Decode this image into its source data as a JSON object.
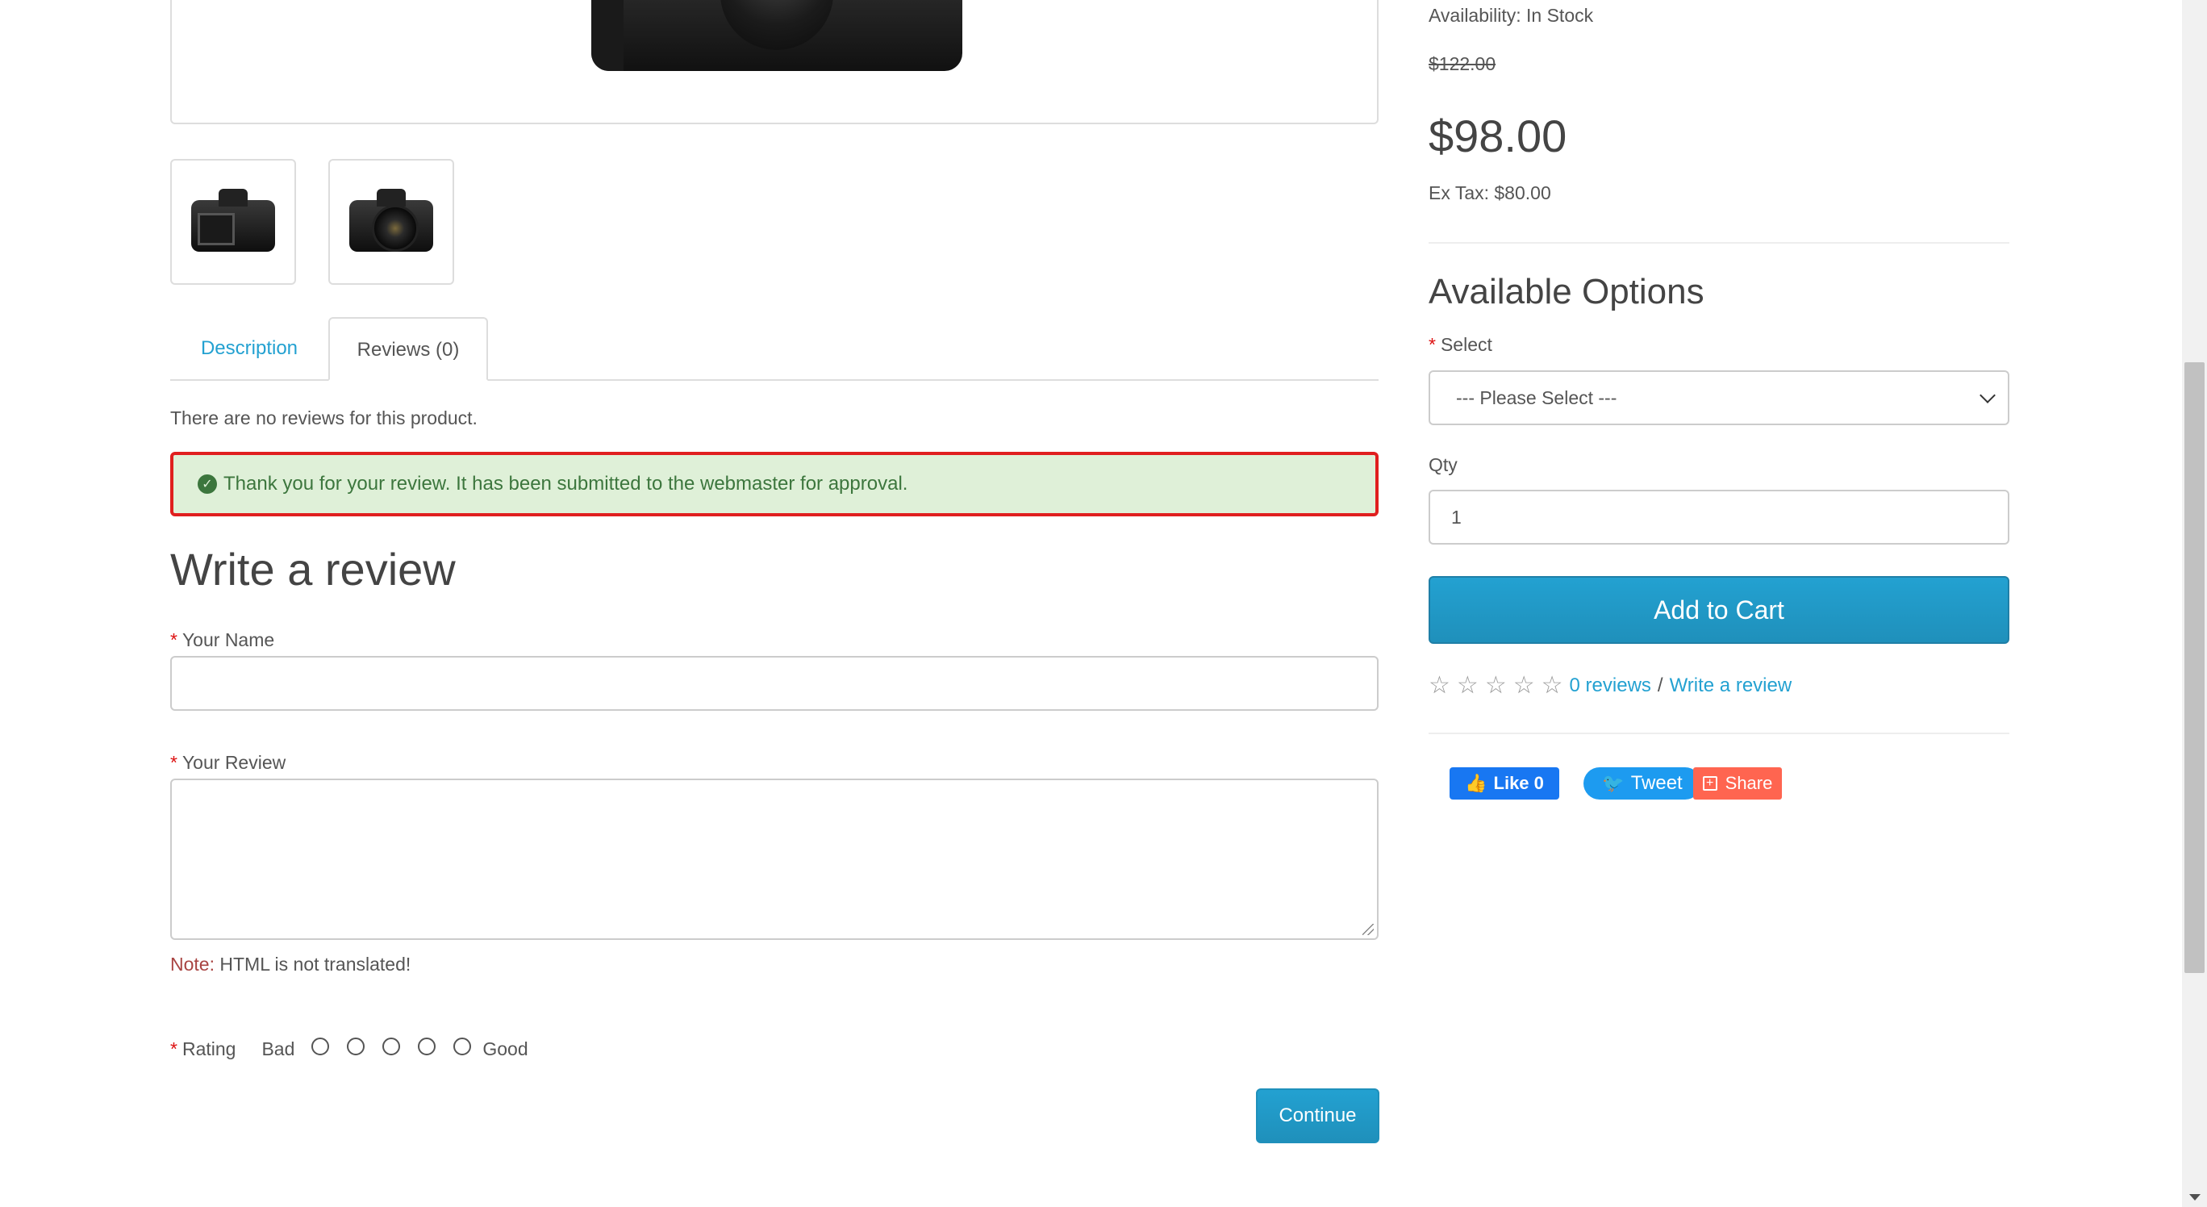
{
  "product": {
    "availability": "Availability: In Stock",
    "old_price": "$122.00",
    "price": "$98.00",
    "ex_tax": "Ex Tax: $80.00"
  },
  "tabs": [
    {
      "label": "Description",
      "active": false
    },
    {
      "label": "Reviews (0)",
      "active": true
    }
  ],
  "reviews": {
    "empty_text": "There are no reviews for this product.",
    "success_alert": "Thank you for your review. It has been submitted to the webmaster for approval.",
    "form_title": "Write a review",
    "name_label": "Your Name",
    "name_value": "",
    "review_label": "Your Review",
    "review_value": "",
    "note_label": "Note:",
    "note_text": " HTML is not translated!",
    "rating_label": "Rating",
    "rating_bad": "Bad",
    "rating_good": "Good",
    "continue_label": "Continue"
  },
  "options": {
    "title": "Available Options",
    "select_label": "Select",
    "select_value": "--- Please Select ---",
    "qty_label": "Qty",
    "qty_value": "1",
    "add_to_cart": "Add to Cart"
  },
  "rating_summary": {
    "stars_filled": 0,
    "stars_total": 5,
    "reviews_link": "0 reviews",
    "separator": "/",
    "write_link": "Write a review"
  },
  "social": {
    "like": "Like 0",
    "tweet": "Tweet",
    "share": "Share"
  },
  "colors": {
    "accent": "#23a1d1",
    "alert_bg": "#dff0d8",
    "alert_border": "#e01f1f",
    "required": "#dd1111",
    "facebook": "#1877f2",
    "twitter": "#1d9bf0",
    "share": "#ff6550"
  }
}
